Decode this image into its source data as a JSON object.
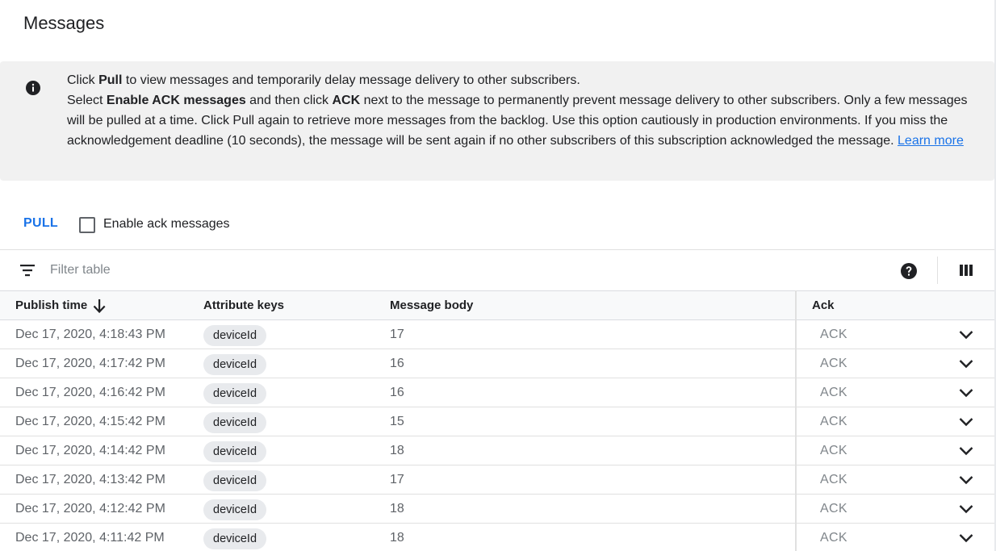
{
  "page": {
    "title": "Messages"
  },
  "info": {
    "line1_pre": "Click ",
    "line1_bold": "Pull",
    "line1_post": " to view messages and temporarily delay message delivery to other subscribers.",
    "line2_pre": "Select ",
    "line2_bold1": "Enable ACK messages",
    "line2_mid": " and then click ",
    "line2_bold2": "ACK",
    "line2_post": " next to the message to permanently prevent message delivery to other subscribers. Only a few messages will be pulled at a time. Click Pull again to retrieve more messages from the backlog. Use this option cautiously in production environments. If you miss the acknowledgement deadline (10 seconds), the message will be sent again if no other subscribers of this subscription acknowledged the message. ",
    "learn_more": "Learn more",
    "icon": "info-icon"
  },
  "toolbar": {
    "pull_label": "PULL",
    "enable_ack_label": "Enable ack messages",
    "enable_ack_checked": false
  },
  "filter": {
    "placeholder": "Filter table",
    "icons": [
      "filter-icon",
      "help-icon",
      "columns-icon"
    ]
  },
  "table": {
    "columns": [
      "Publish time",
      "Attribute keys",
      "Message body",
      "Ack"
    ],
    "sort": {
      "column": "Publish time",
      "direction": "descending"
    },
    "ack_label": "ACK",
    "rows": [
      {
        "publish_time": "Dec 17, 2020, 4:18:43 PM",
        "attribute_key": "deviceId",
        "message_body": "17"
      },
      {
        "publish_time": "Dec 17, 2020, 4:17:42 PM",
        "attribute_key": "deviceId",
        "message_body": "16"
      },
      {
        "publish_time": "Dec 17, 2020, 4:16:42 PM",
        "attribute_key": "deviceId",
        "message_body": "16"
      },
      {
        "publish_time": "Dec 17, 2020, 4:15:42 PM",
        "attribute_key": "deviceId",
        "message_body": "15"
      },
      {
        "publish_time": "Dec 17, 2020, 4:14:42 PM",
        "attribute_key": "deviceId",
        "message_body": "18"
      },
      {
        "publish_time": "Dec 17, 2020, 4:13:42 PM",
        "attribute_key": "deviceId",
        "message_body": "17"
      },
      {
        "publish_time": "Dec 17, 2020, 4:12:42 PM",
        "attribute_key": "deviceId",
        "message_body": "18"
      },
      {
        "publish_time": "Dec 17, 2020, 4:11:42 PM",
        "attribute_key": "deviceId",
        "message_body": "18"
      }
    ]
  },
  "colors": {
    "accent": "#1a73e8",
    "info_background": "#f1f1f1",
    "chip_background": "#e8eaed",
    "ack_text": "#80868b"
  }
}
